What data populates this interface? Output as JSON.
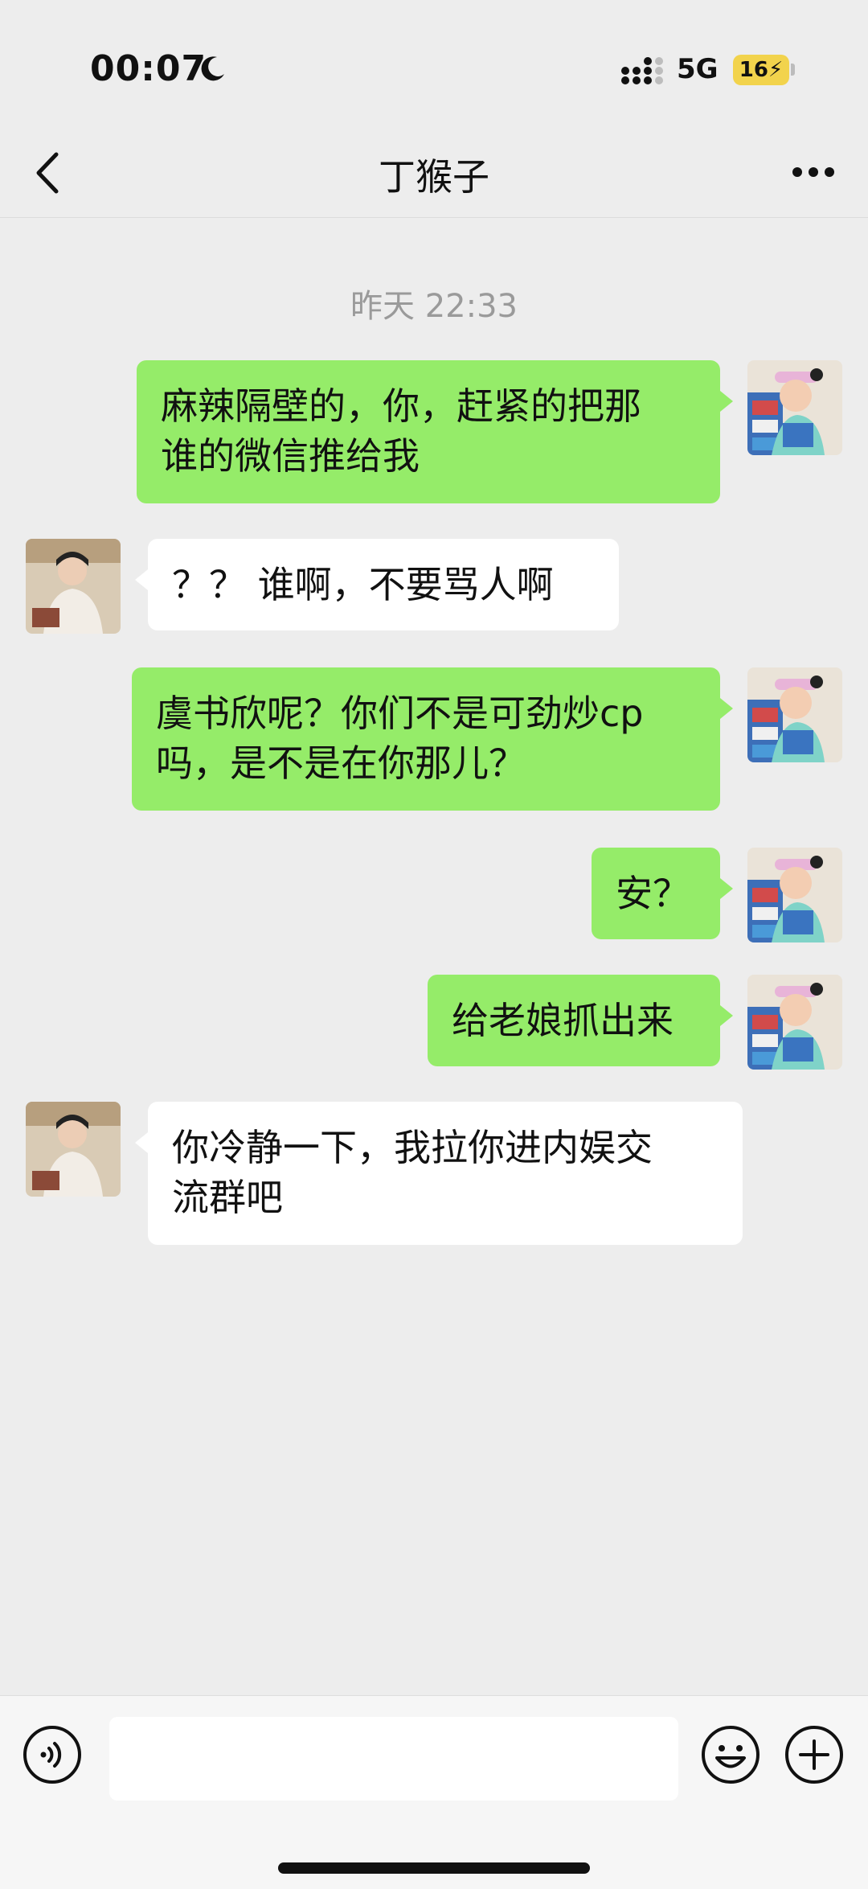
{
  "status_bar": {
    "time": "00:07",
    "network": "5G",
    "battery": "16",
    "icons": [
      "moon-icon",
      "signal-icon",
      "battery-charging-icon"
    ]
  },
  "nav": {
    "title": "丁猴子",
    "icons": [
      "back-icon",
      "more-icon"
    ]
  },
  "chat": {
    "timestamp": "昨天 22:33",
    "messages": [
      {
        "sender": "self",
        "lines": [
          "麻辣隔壁的，你，赶紧的把那",
          "谁的微信推给我"
        ]
      },
      {
        "sender": "other",
        "lines": [
          "？？ 谁啊，不要骂人啊"
        ]
      },
      {
        "sender": "self",
        "lines": [
          "虞书欣呢？你们不是可劲炒cp",
          "吗，是不是在你那儿？"
        ]
      },
      {
        "sender": "self",
        "lines": [
          "安？"
        ]
      },
      {
        "sender": "self",
        "lines": [
          "给老娘抓出来"
        ]
      },
      {
        "sender": "other",
        "lines": [
          "你冷静一下，我拉你进内娱交",
          "流群吧"
        ]
      }
    ]
  },
  "input_bar": {
    "value": "",
    "icons": [
      "voice-icon",
      "emoji-icon",
      "plus-icon"
    ]
  },
  "colors": {
    "background": "#ededed",
    "self_bubble": "#95ec69",
    "other_bubble": "#ffffff",
    "battery": "#f2d34c"
  }
}
